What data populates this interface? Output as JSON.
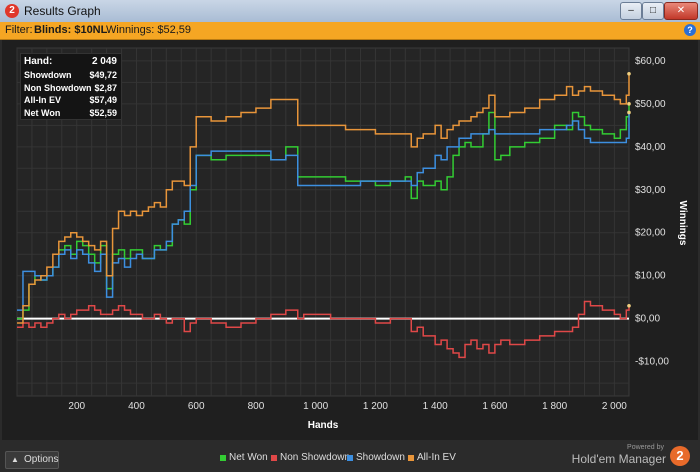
{
  "window": {
    "title": "Results Graph",
    "icon": "2"
  },
  "filter": {
    "prefix": "Filter:",
    "blinds": "Blinds: $10NL",
    "winnings": "Winnings: $52,59"
  },
  "stats": [
    {
      "label": "Hand:",
      "value": "2 049"
    },
    {
      "label": "Showdown",
      "value": "$49,72"
    },
    {
      "label": "Non Showdown",
      "value": "$2,87"
    },
    {
      "label": "All-In EV",
      "value": "$57,49"
    },
    {
      "label": "Net Won",
      "value": "$52,59"
    }
  ],
  "options": {
    "label": "Options"
  },
  "brand": {
    "powered": "Powered by",
    "name": "Hold'em Manager",
    "logo": "2"
  },
  "chart_data": {
    "type": "line",
    "xlabel": "Hands",
    "ylabel": "Winnings",
    "xlim": [
      0,
      2049
    ],
    "ylim": [
      -18,
      63
    ],
    "xticks": [
      200,
      400,
      600,
      800,
      1000,
      1200,
      1400,
      1600,
      1800,
      2000
    ],
    "xtick_labels": [
      "200",
      "400",
      "600",
      "800",
      "1 000",
      "1 200",
      "1 400",
      "1 600",
      "1 800",
      "2 000"
    ],
    "yticks": [
      -10,
      0,
      10,
      20,
      30,
      40,
      50,
      60
    ],
    "ytick_labels": [
      "-$10,00",
      "$0,00",
      "$10,00",
      "$20,00",
      "$30,00",
      "$40,00",
      "$50,00",
      "$60,00"
    ],
    "grid": true,
    "legend_position": "bottom",
    "series": [
      {
        "name": "Net Won",
        "color": "#33cc33",
        "x": [
          0,
          20,
          40,
          60,
          80,
          100,
          120,
          140,
          160,
          180,
          200,
          220,
          240,
          260,
          280,
          300,
          320,
          340,
          360,
          380,
          400,
          420,
          440,
          460,
          480,
          500,
          520,
          540,
          560,
          580,
          600,
          650,
          700,
          750,
          800,
          850,
          900,
          940,
          960,
          1000,
          1050,
          1100,
          1150,
          1200,
          1250,
          1300,
          1320,
          1340,
          1360,
          1400,
          1420,
          1440,
          1460,
          1480,
          1500,
          1520,
          1540,
          1560,
          1580,
          1600,
          1620,
          1650,
          1700,
          1750,
          1800,
          1840,
          1860,
          1880,
          1900,
          1920,
          1960,
          2000,
          2020,
          2040,
          2049
        ],
        "y": [
          0,
          2,
          8,
          10,
          9,
          10,
          12,
          16,
          17,
          15,
          18,
          17,
          15,
          13,
          17,
          7,
          15,
          16,
          14,
          16,
          16,
          14,
          14,
          17,
          16,
          17,
          22,
          23,
          22,
          30,
          38,
          37,
          38,
          38,
          38,
          37,
          40,
          33,
          33,
          33,
          33,
          32,
          32,
          31,
          32,
          33,
          28,
          32,
          31,
          32,
          30,
          33,
          38,
          40,
          41,
          40,
          40,
          43,
          48,
          37,
          38,
          40,
          41,
          42,
          45,
          44,
          48,
          47,
          45,
          44,
          43,
          42,
          44,
          47,
          50
        ]
      },
      {
        "name": "Non Showdown",
        "color": "#e04848",
        "x": [
          0,
          20,
          40,
          60,
          80,
          100,
          120,
          140,
          160,
          180,
          200,
          220,
          240,
          260,
          280,
          300,
          320,
          340,
          360,
          380,
          400,
          420,
          440,
          460,
          480,
          500,
          520,
          540,
          560,
          580,
          600,
          650,
          700,
          750,
          800,
          850,
          900,
          940,
          960,
          1000,
          1050,
          1100,
          1150,
          1200,
          1250,
          1300,
          1320,
          1340,
          1360,
          1400,
          1420,
          1440,
          1460,
          1480,
          1500,
          1520,
          1540,
          1560,
          1580,
          1600,
          1620,
          1650,
          1700,
          1750,
          1800,
          1840,
          1860,
          1880,
          1900,
          1920,
          1960,
          2000,
          2020,
          2040,
          2049
        ],
        "y": [
          -2,
          -1,
          -2,
          -1,
          -2,
          -1,
          0,
          1,
          0,
          1,
          2,
          2,
          3,
          2,
          1,
          1,
          2,
          3,
          2,
          1,
          1,
          0,
          0,
          1,
          0,
          -1,
          0,
          0,
          -3,
          -1,
          0,
          -1,
          -2,
          -1,
          0,
          1,
          2,
          0,
          1,
          1,
          0,
          0,
          0,
          -1,
          0,
          0,
          -3,
          -2,
          -4,
          -6,
          -5,
          -7,
          -8,
          -9,
          -6,
          -5,
          -7,
          -6,
          -8,
          -6,
          -5,
          -6,
          -5,
          -4,
          -3,
          -3,
          -2,
          1,
          4,
          3,
          2,
          1,
          0,
          2,
          3
        ]
      },
      {
        "name": "Showdown",
        "color": "#3d8fe0",
        "x": [
          0,
          20,
          40,
          60,
          80,
          100,
          120,
          140,
          160,
          180,
          200,
          220,
          240,
          260,
          280,
          300,
          320,
          340,
          360,
          380,
          400,
          420,
          440,
          460,
          480,
          500,
          520,
          540,
          560,
          580,
          600,
          650,
          700,
          750,
          800,
          850,
          900,
          940,
          960,
          1000,
          1050,
          1100,
          1150,
          1200,
          1250,
          1300,
          1320,
          1340,
          1360,
          1400,
          1420,
          1440,
          1460,
          1480,
          1500,
          1520,
          1540,
          1560,
          1580,
          1600,
          1620,
          1650,
          1700,
          1750,
          1800,
          1840,
          1860,
          1880,
          1900,
          1920,
          1960,
          2000,
          2020,
          2040,
          2049
        ],
        "y": [
          2,
          11,
          11,
          10,
          9,
          10,
          12,
          15,
          16,
          14,
          16,
          15,
          13,
          11,
          15,
          5,
          13,
          14,
          12,
          14,
          15,
          14,
          14,
          16,
          16,
          18,
          22,
          23,
          25,
          31,
          38,
          39,
          39,
          39,
          39,
          37,
          38,
          31,
          31,
          31,
          31,
          31,
          32,
          32,
          32,
          32,
          31,
          34,
          35,
          38,
          37,
          40,
          40,
          42,
          42,
          43,
          43,
          43,
          44,
          43,
          43,
          43,
          43,
          44,
          44,
          45,
          46,
          44,
          42,
          41,
          41,
          41,
          41,
          42,
          48
        ]
      },
      {
        "name": "All-In EV",
        "color": "#e8953a",
        "x": [
          0,
          20,
          40,
          60,
          80,
          100,
          120,
          140,
          160,
          180,
          200,
          220,
          240,
          260,
          280,
          300,
          320,
          340,
          360,
          380,
          400,
          420,
          440,
          460,
          480,
          500,
          520,
          540,
          560,
          580,
          600,
          650,
          700,
          750,
          800,
          850,
          900,
          940,
          960,
          1000,
          1050,
          1100,
          1150,
          1200,
          1250,
          1300,
          1320,
          1340,
          1360,
          1400,
          1420,
          1440,
          1460,
          1480,
          1500,
          1520,
          1540,
          1560,
          1580,
          1600,
          1620,
          1650,
          1700,
          1750,
          1800,
          1840,
          1860,
          1880,
          1900,
          1920,
          1960,
          2000,
          2020,
          2040,
          2049
        ],
        "y": [
          -1,
          3,
          8,
          9,
          10,
          12,
          15,
          18,
          19,
          20,
          19,
          18,
          17,
          16,
          18,
          10,
          21,
          25,
          24,
          25,
          24,
          25,
          26,
          27,
          26,
          30,
          32,
          32,
          31,
          40,
          47,
          46,
          47,
          48,
          49,
          51,
          51,
          45,
          45,
          45,
          45,
          44,
          44,
          43,
          43,
          43,
          40,
          42,
          43,
          45,
          42,
          44,
          45,
          46,
          46,
          47,
          48,
          49,
          52,
          47,
          47,
          48,
          49,
          51,
          52,
          54,
          52,
          53,
          54,
          53,
          52,
          51,
          50,
          52,
          57
        ]
      }
    ]
  }
}
